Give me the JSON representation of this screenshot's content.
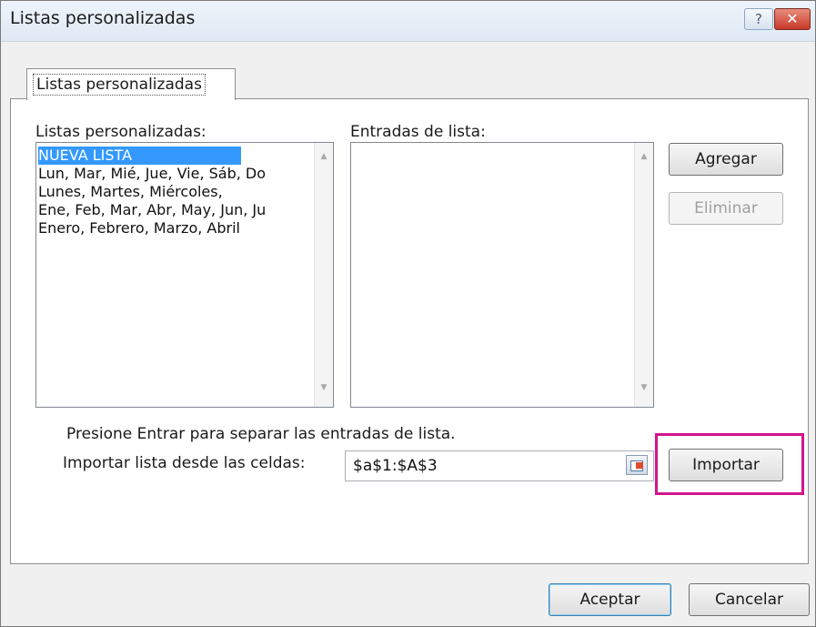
{
  "window": {
    "title": "Listas personalizadas",
    "help_glyph": "?",
    "close_glyph": "✕"
  },
  "tab": {
    "label": "Listas personalizadas"
  },
  "custom_lists": {
    "label": "Listas personalizadas:",
    "items": [
      "NUEVA LISTA",
      "Lun, Mar, Mié, Jue, Vie, Sáb, Do",
      "Lunes, Martes, Miércoles,",
      "Ene, Feb, Mar, Abr, May, Jun, Ju",
      "Enero, Febrero, Marzo, Abril"
    ],
    "selected_index": 0
  },
  "list_entries": {
    "label": "Entradas de lista:",
    "value": ""
  },
  "buttons": {
    "add": "Agregar",
    "delete": "Eliminar",
    "import": "Importar",
    "ok": "Aceptar",
    "cancel": "Cancelar"
  },
  "hint": "Presione Entrar para separar las entradas de lista.",
  "import_field": {
    "label": "Importar lista desde las celdas:",
    "value": "$a$1:$A$3"
  },
  "colors": {
    "selection": "#3399ff",
    "highlight": "#d4148c",
    "close": "#c8392a"
  }
}
